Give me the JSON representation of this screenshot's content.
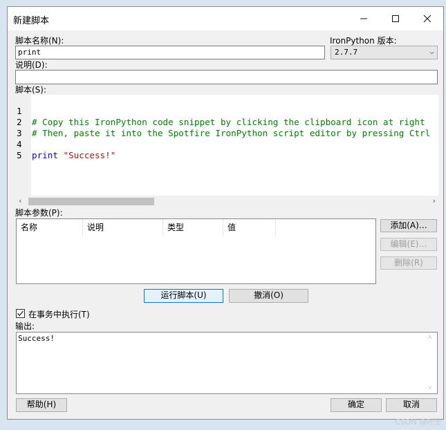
{
  "window": {
    "title": "新建脚本",
    "minimize_icon": "minimize-icon",
    "maximize_icon": "maximize-icon",
    "close_icon": "close-icon"
  },
  "form": {
    "name_label": "脚本名称(N):",
    "name_value": "print",
    "version_label": "IronPython 版本:",
    "version_value": "2.7.7",
    "description_label": "说明(D):",
    "description_value": "",
    "script_label": "脚本(S):"
  },
  "editor": {
    "lines": [
      {
        "number": "1",
        "text": "# Copy this IronPython code snippet by clicking the clipboard icon at right"
      },
      {
        "number": "2",
        "text": "# Then, paste it into the Spotfire IronPython script editor by pressing Ctrl"
      },
      {
        "number": "3",
        "text": ""
      },
      {
        "number": "4",
        "keyword": "print",
        "string": "\"Success!\""
      },
      {
        "number": "5",
        "text": ""
      }
    ]
  },
  "parameters": {
    "label": "脚本参数(P):",
    "columns": [
      "名称",
      "说明",
      "类型",
      "值"
    ],
    "rows": [],
    "add_button": "添加(A)…",
    "edit_button": "编辑(E)…",
    "delete_button": "删除(R)"
  },
  "actions": {
    "run_button": "运行脚本(U)",
    "undo_button": "撤消(O)"
  },
  "transaction": {
    "label": "在事务中执行(T)",
    "checked": true
  },
  "output": {
    "label": "输出:",
    "text": "Success!"
  },
  "footer": {
    "help_button": "帮助(H)",
    "ok_button": "确定",
    "cancel_button": "取消"
  },
  "watermark": "CSDN @叶士"
}
